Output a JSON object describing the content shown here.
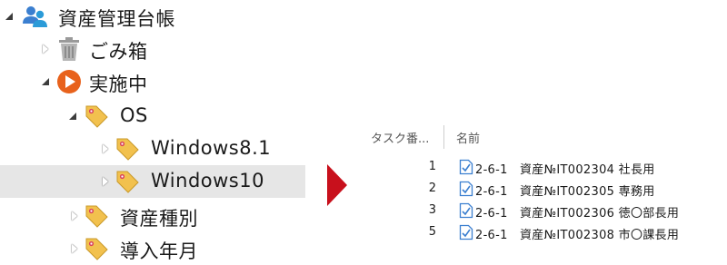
{
  "tree": {
    "root": {
      "label": "資産管理台帳",
      "expanded": true,
      "icon": "users-icon"
    },
    "trash": {
      "label": "ごみ箱",
      "expanded": false,
      "icon": "trash-icon"
    },
    "active": {
      "label": "実施中",
      "expanded": true,
      "icon": "play-circle-icon"
    },
    "os": {
      "label": "OS",
      "expanded": true,
      "icon": "tag-icon"
    },
    "win81": {
      "label": "Windows8.1",
      "expanded": false,
      "icon": "tag-icon"
    },
    "win10": {
      "label": "Windows10",
      "expanded": false,
      "selected": true,
      "icon": "tag-icon"
    },
    "asset_type": {
      "label": "資産種別",
      "expanded": false,
      "icon": "tag-icon"
    },
    "install_year": {
      "label": "導入年月",
      "expanded": false,
      "icon": "tag-icon"
    }
  },
  "colors": {
    "selection": "#e6e6e6",
    "arrow": "#c8101c",
    "play": "#e8621c",
    "tag": "#f2c14e"
  },
  "task_list": {
    "headers": {
      "number": "タスク番...",
      "name": "名前"
    },
    "rows": [
      {
        "number": "1",
        "name": "2-6-1　資産№IT002304 社長用"
      },
      {
        "number": "2",
        "name": "2-6-1　資産№IT002305 専務用"
      },
      {
        "number": "3",
        "name": "2-6-1　資産№IT002306 徳〇部長用"
      },
      {
        "number": "5",
        "name": "2-6-1　資産№IT002308 市〇課長用"
      }
    ]
  }
}
